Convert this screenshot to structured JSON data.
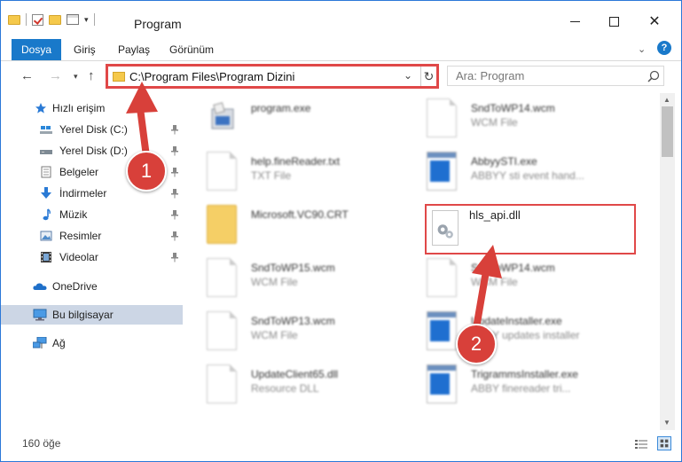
{
  "window": {
    "title": "Program",
    "controls": {
      "minimize": "minimize",
      "maximize": "maximize",
      "close": "✕"
    }
  },
  "ribbon": {
    "tabs": [
      "Dosya",
      "Giriş",
      "Paylaş",
      "Görünüm"
    ],
    "help": "?",
    "accent": "#1979ca"
  },
  "navbar": {
    "path": "C:\\Program Files\\Program Dizini",
    "search_placeholder": "Ara: Program"
  },
  "sidebar": {
    "quick_access": "Hızlı erişim",
    "items": [
      {
        "label": "Yerel Disk (C:)",
        "icon": "drive-c-icon",
        "pinned": true
      },
      {
        "label": "Yerel Disk (D:)",
        "icon": "drive-d-icon",
        "pinned": true
      },
      {
        "label": "Belgeler",
        "icon": "documents-icon",
        "pinned": true
      },
      {
        "label": "İndirmeler",
        "icon": "downloads-icon",
        "pinned": true
      },
      {
        "label": "Müzik",
        "icon": "music-icon",
        "pinned": true
      },
      {
        "label": "Resimler",
        "icon": "pictures-icon",
        "pinned": true
      },
      {
        "label": "Videolar",
        "icon": "videos-icon",
        "pinned": true
      }
    ],
    "onedrive": "OneDrive",
    "this_pc": "Bu bilgisayar",
    "network": "Ağ"
  },
  "files": {
    "left": [
      {
        "name": "program.exe",
        "type": "",
        "icon": "installer-icon"
      },
      {
        "name": "help.fineReader.txt",
        "type": "TXT File",
        "icon": "text-file-icon"
      },
      {
        "name": "Microsoft.VC90.CRT",
        "type": "",
        "icon": "folder-icon"
      },
      {
        "name": "SndToWP15.wcm",
        "type": "WCM File",
        "icon": "file-icon"
      },
      {
        "name": "SndToWP13.wcm",
        "type": "WCM File",
        "icon": "file-icon"
      },
      {
        "name": "UpdateClient65.dll",
        "type": "Resource DLL",
        "icon": "dll-icon"
      }
    ],
    "right": [
      {
        "name": "SndToWP14.wcm",
        "type": "WCM File",
        "icon": "file-icon"
      },
      {
        "name": "AbbyySTI.exe",
        "type": "ABBYY sti event hand...",
        "icon": "exe-icon"
      },
      {
        "name": "hls_api.dll",
        "type": "",
        "icon": "dll-gear-icon",
        "highlighted": true
      },
      {
        "name": "SndToWP14.wcm",
        "type": "WCM File",
        "icon": "file-icon"
      },
      {
        "name": "UpdateInstaller.exe",
        "type": "ABBY updates installer",
        "icon": "exe-icon"
      },
      {
        "name": "TrigrammsInstaller.exe",
        "type": "ABBY finereader tri...",
        "icon": "exe-icon"
      }
    ]
  },
  "status": {
    "count": "160 öğe"
  },
  "annotations": {
    "step1": "1",
    "step2": "2",
    "color": "#d8403a"
  }
}
